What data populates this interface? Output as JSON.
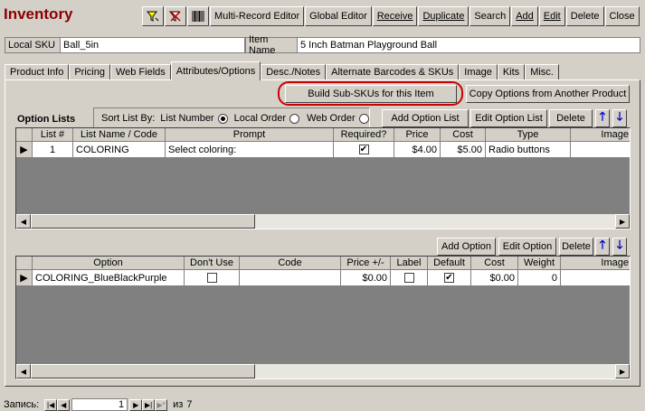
{
  "app": {
    "title": "Inventory"
  },
  "toolbar": {
    "icons": [
      "filter-icon",
      "remove-filter-icon",
      "barcode-icon"
    ],
    "buttons": [
      "Multi-Record Editor",
      "Global Editor",
      "Receive",
      "Duplicate",
      "Search",
      "Add",
      "Edit",
      "Delete",
      "Close"
    ]
  },
  "header": {
    "sku_label": "Local SKU",
    "sku_value": "Ball_5in",
    "name_label": "Item Name",
    "name_value": "5 Inch Batman Playground Ball"
  },
  "tabs": [
    "Product Info",
    "Pricing",
    "Web Fields",
    "Attributes/Options",
    "Desc./Notes",
    "Alternate Barcodes & SKUs",
    "Image",
    "Kits",
    "Misc."
  ],
  "active_tab": "Attributes/Options",
  "actions": {
    "build_subskus": "Build Sub-SKUs for this Item",
    "copy_options": "Copy Options from Another Product"
  },
  "option_lists": {
    "title": "Option Lists",
    "sort_label": "Sort List By:",
    "sort_options": [
      "List Number",
      "Local Order",
      "Web Order"
    ],
    "sort_selected": "List Number",
    "buttons": {
      "add": "Add Option List",
      "edit": "Edit Option List",
      "delete": "Delete"
    },
    "columns": [
      "List #",
      "List Name / Code",
      "Prompt",
      "Required?",
      "Price",
      "Cost",
      "Type",
      "Image"
    ],
    "rows": [
      {
        "list_no": "1",
        "name": "COLORING",
        "prompt": "Select coloring:",
        "required": true,
        "price": "$4.00",
        "cost": "$5.00",
        "type": "Radio buttons",
        "image": ""
      }
    ]
  },
  "options": {
    "buttons": {
      "add": "Add Option",
      "edit": "Edit Option",
      "delete": "Delete"
    },
    "columns": [
      "Option",
      "Don't Use",
      "Code",
      "Price +/-",
      "Label",
      "Default",
      "Cost",
      "Weight",
      "Image"
    ],
    "rows": [
      {
        "option": "COLORING_BlueBlackPurple",
        "dont_use": false,
        "code": "",
        "price": "$0.00",
        "label": false,
        "default": true,
        "cost": "$0.00",
        "weight": "0",
        "image": ""
      }
    ]
  },
  "record_nav": {
    "label": "Запись:",
    "current": "1",
    "of": "из",
    "total": "7"
  },
  "colors": {
    "title": "#8b0000",
    "highlight_ring": "#cc0000",
    "arrow": "#0000cc"
  }
}
